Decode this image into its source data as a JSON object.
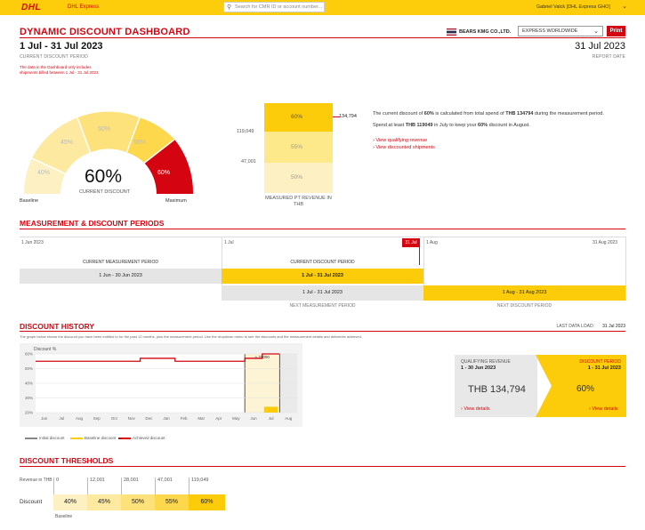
{
  "header": {
    "logo": "DHL",
    "brand": "DHL Express",
    "search_placeholder": "Search for CMR ID or account number...",
    "user": "Gabriel Valck [DHL Express GHO]"
  },
  "title": "DYNAMIC DISCOUNT DASHBOARD",
  "current_period": {
    "dates": "1 Jul - 31 Jul 2023",
    "caption": "CURRENT DISCOUNT PERIOD"
  },
  "report_date": {
    "date": "31 Jul 2023",
    "caption": "REPORT DATE"
  },
  "note": "The data in the Dashboard only includes shipments billed between 1 Jul - 31 Jul 2023",
  "company": "BEARS KMG CO.,LTD.",
  "product_select": "EXPRESS WORLDWIDE",
  "print_label": "Print",
  "gauge": {
    "segments": [
      "40%",
      "45%",
      "50%",
      "55%",
      "60%"
    ],
    "value": "60%",
    "caption": "CURRENT DISCOUNT",
    "baseline": "Baseline",
    "maximum": "Maximum"
  },
  "revenue_bar": {
    "levels": [
      "50%",
      "55%",
      "60%"
    ],
    "ticks": [
      "119,049",
      "47,001"
    ],
    "marker": "134,794",
    "caption": "MEASURED PT REVENUE IN THB",
    "current_fill": 0.92
  },
  "summary": {
    "line1_a": "The current discount of ",
    "line1_b": "60%",
    "line1_c": " is calculated from total spend of ",
    "line1_d": "THB 134794",
    "line1_e": " during the measurement period.",
    "line2_a": "Spend at least ",
    "line2_b": "THB 119049",
    "line2_c": " in July to keep your ",
    "line2_d": "60%",
    "line2_e": " discount in August.",
    "link1": "View qualifying revenue",
    "link2": "View discounted shipments"
  },
  "periods": {
    "title": "MEASUREMENT & DISCOUNT PERIODS",
    "axis": [
      "1 Jun 2023",
      "1 Jul",
      "31 Jul",
      "1 Aug",
      "31 Aug 2023"
    ],
    "current_measurement_label": "CURRENT MEASUREMENT PERIOD",
    "current_measurement_dates": "1 Jun - 30 Jun 2023",
    "current_discount_label": "CURRENT DISCOUNT PERIOD",
    "current_discount_dates": "1 Jul - 31 Jul 2023",
    "next_measurement_dates": "1 Jul - 31 Jul 2023",
    "next_measurement_label": "NEXT MEASUREMENT PERIOD",
    "next_discount_dates": "1 Aug - 31 Aug 2023",
    "next_discount_label": "NEXT DISCOUNT PERIOD"
  },
  "history": {
    "title": "DISCOUNT HISTORY",
    "last_load_label": "LAST DATA LOAD:",
    "last_load_date": "31 Jul 2023",
    "desc": "The graph below shows the discount you have been entitled to for the past 12 months, plus the measurement period. Use the dropdown menu to see the discounts and the measurement details and deliveries achieved.",
    "y_caption": "Discount %",
    "legend": [
      "Initial discount",
      "Baseline discount",
      "Achieved discount"
    ],
    "qualifying_label": "QUALIFYING REVENUE",
    "qualifying_dates": "1 - 30 Jun 2023",
    "qualifying_value": "THB 134,794",
    "discount_label": "DISCOUNT PERIOD",
    "discount_dates": "1 - 31 Jul 2023",
    "discount_value": "60%",
    "view_details": "View details"
  },
  "chart_data": {
    "type": "line",
    "x": [
      "Jun",
      "Jul",
      "Aug",
      "Sep",
      "Oct",
      "Nov",
      "Dec",
      "Jan",
      "Feb",
      "Mar",
      "Apr",
      "May",
      "Jun",
      "Jul",
      "Aug"
    ],
    "y_ticks": [
      "60%",
      "50%",
      "40%",
      "30%",
      "20%"
    ],
    "ylim": [
      20,
      60
    ],
    "series": [
      {
        "name": "Achieved discount",
        "values": [
          55,
          55,
          55,
          55,
          55,
          55,
          57,
          57,
          55,
          55,
          55,
          55,
          57,
          60,
          null
        ]
      }
    ],
    "annotation": "≈ 70000",
    "highlight_range": [
      "Jun",
      "Jul"
    ]
  },
  "thresholds": {
    "title": "DISCOUNT THRESHOLDS",
    "rev_label": "Revenue in THB",
    "revenue": [
      "0",
      "12,001",
      "28,001",
      "47,001",
      "119,049"
    ],
    "discount_label": "Discount",
    "discounts": [
      "40%",
      "45%",
      "50%",
      "55%",
      "60%"
    ],
    "baseline": "Baseline",
    "colors": [
      "#fdf1c4",
      "#fde9a0",
      "#fde17a",
      "#fdd84d",
      "#fccc0a"
    ]
  }
}
